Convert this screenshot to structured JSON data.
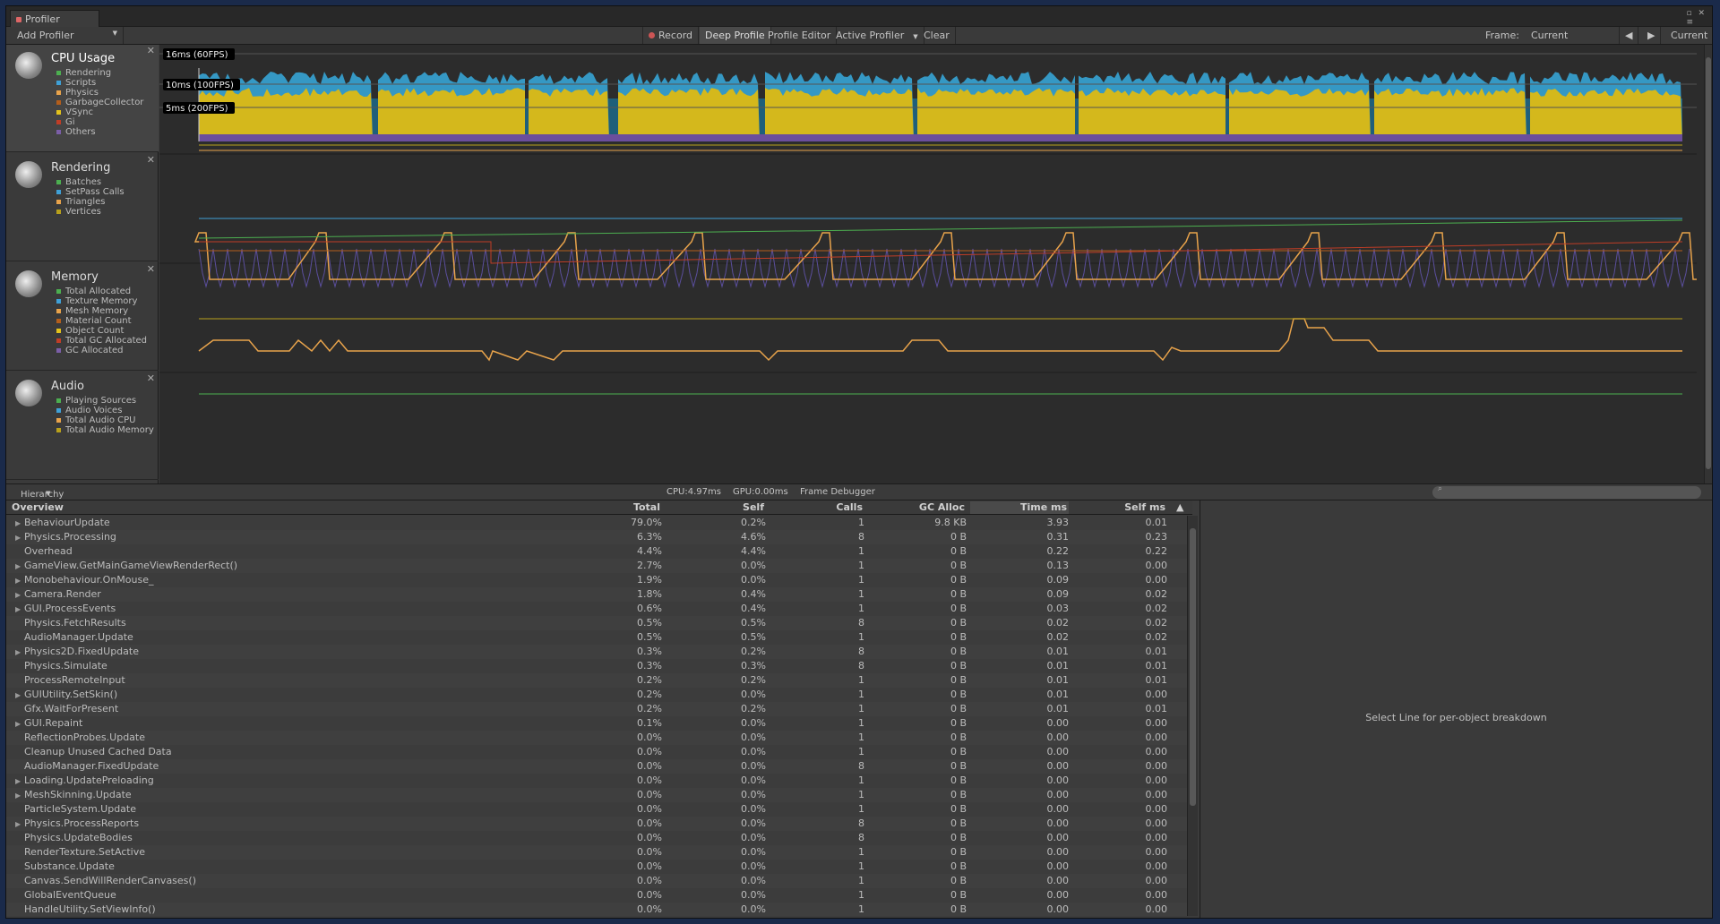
{
  "window": {
    "tab_title": "Profiler"
  },
  "toolbar": {
    "add_profiler": "Add Profiler",
    "record": "Record",
    "deep_profile": "Deep Profile",
    "profile_editor": "Profile Editor",
    "active_profiler": "Active Profiler",
    "clear": "Clear",
    "frame_label": "Frame:",
    "frame_value": "Current",
    "current": "Current"
  },
  "cpu_labels": {
    "l60": "16ms (60FPS)",
    "l100": "10ms (100FPS)",
    "l200": "5ms (200FPS)"
  },
  "legend": [
    {
      "title": "CPU Usage",
      "icon": "cpu-usage-icon",
      "items": [
        {
          "label": "Rendering",
          "color": "#4caf50"
        },
        {
          "label": "Scripts",
          "color": "#3fa0d6"
        },
        {
          "label": "Physics",
          "color": "#e8a34b"
        },
        {
          "label": "GarbageCollector",
          "color": "#b35e1c"
        },
        {
          "label": "VSync",
          "color": "#e2c21c"
        },
        {
          "label": "Gi",
          "color": "#c03d26"
        },
        {
          "label": "Others",
          "color": "#7b5ea7"
        }
      ]
    },
    {
      "title": "Rendering",
      "icon": "rendering-icon",
      "items": [
        {
          "label": "Batches",
          "color": "#4caf50"
        },
        {
          "label": "SetPass Calls",
          "color": "#3fa0d6"
        },
        {
          "label": "Triangles",
          "color": "#e8a34b"
        },
        {
          "label": "Vertices",
          "color": "#b8a01c"
        }
      ]
    },
    {
      "title": "Memory",
      "icon": "memory-icon",
      "items": [
        {
          "label": "Total Allocated",
          "color": "#4caf50"
        },
        {
          "label": "Texture Memory",
          "color": "#3fa0d6"
        },
        {
          "label": "Mesh Memory",
          "color": "#e8a34b"
        },
        {
          "label": "Material Count",
          "color": "#b35e1c"
        },
        {
          "label": "Object Count",
          "color": "#e2c21c"
        },
        {
          "label": "Total GC Allocated",
          "color": "#c03d26"
        },
        {
          "label": "GC Allocated",
          "color": "#7b5ea7"
        }
      ]
    },
    {
      "title": "Audio",
      "icon": "audio-icon",
      "items": [
        {
          "label": "Playing Sources",
          "color": "#4caf50"
        },
        {
          "label": "Audio Voices",
          "color": "#3fa0d6"
        },
        {
          "label": "Total Audio CPU",
          "color": "#e8a34b"
        },
        {
          "label": "Total Audio Memory",
          "color": "#b8a01c"
        }
      ]
    }
  ],
  "hier": {
    "mode": "Hierarchy",
    "cpu": "CPU:4.97ms",
    "gpu": "GPU:0.00ms",
    "frame_debugger": "Frame Debugger"
  },
  "columns": [
    "Overview",
    "Total",
    "Self",
    "Calls",
    "GC Alloc",
    "Time ms",
    "Self ms"
  ],
  "rows": [
    {
      "n": "BehaviourUpdate",
      "e": true,
      "v": [
        "79.0%",
        "0.2%",
        "1",
        "9.8 KB",
        "3.93",
        "0.01"
      ]
    },
    {
      "n": "Physics.Processing",
      "e": true,
      "v": [
        "6.3%",
        "4.6%",
        "8",
        "0 B",
        "0.31",
        "0.23"
      ]
    },
    {
      "n": "Overhead",
      "e": false,
      "v": [
        "4.4%",
        "4.4%",
        "1",
        "0 B",
        "0.22",
        "0.22"
      ]
    },
    {
      "n": "GameView.GetMainGameViewRenderRect()",
      "e": true,
      "v": [
        "2.7%",
        "0.0%",
        "1",
        "0 B",
        "0.13",
        "0.00"
      ]
    },
    {
      "n": "Monobehaviour.OnMouse_",
      "e": true,
      "v": [
        "1.9%",
        "0.0%",
        "1",
        "0 B",
        "0.09",
        "0.00"
      ]
    },
    {
      "n": "Camera.Render",
      "e": true,
      "v": [
        "1.8%",
        "0.4%",
        "1",
        "0 B",
        "0.09",
        "0.02"
      ]
    },
    {
      "n": "GUI.ProcessEvents",
      "e": true,
      "v": [
        "0.6%",
        "0.4%",
        "1",
        "0 B",
        "0.03",
        "0.02"
      ]
    },
    {
      "n": "Physics.FetchResults",
      "e": false,
      "v": [
        "0.5%",
        "0.5%",
        "8",
        "0 B",
        "0.02",
        "0.02"
      ]
    },
    {
      "n": "AudioManager.Update",
      "e": false,
      "v": [
        "0.5%",
        "0.5%",
        "1",
        "0 B",
        "0.02",
        "0.02"
      ]
    },
    {
      "n": "Physics2D.FixedUpdate",
      "e": true,
      "v": [
        "0.3%",
        "0.2%",
        "8",
        "0 B",
        "0.01",
        "0.01"
      ]
    },
    {
      "n": "Physics.Simulate",
      "e": false,
      "v": [
        "0.3%",
        "0.3%",
        "8",
        "0 B",
        "0.01",
        "0.01"
      ]
    },
    {
      "n": "ProcessRemoteInput",
      "e": false,
      "v": [
        "0.2%",
        "0.2%",
        "1",
        "0 B",
        "0.01",
        "0.01"
      ]
    },
    {
      "n": "GUIUtility.SetSkin()",
      "e": true,
      "v": [
        "0.2%",
        "0.0%",
        "1",
        "0 B",
        "0.01",
        "0.00"
      ]
    },
    {
      "n": "Gfx.WaitForPresent",
      "e": false,
      "v": [
        "0.2%",
        "0.2%",
        "1",
        "0 B",
        "0.01",
        "0.01"
      ]
    },
    {
      "n": "GUI.Repaint",
      "e": true,
      "v": [
        "0.1%",
        "0.0%",
        "1",
        "0 B",
        "0.00",
        "0.00"
      ]
    },
    {
      "n": "ReflectionProbes.Update",
      "e": false,
      "v": [
        "0.0%",
        "0.0%",
        "1",
        "0 B",
        "0.00",
        "0.00"
      ]
    },
    {
      "n": "Cleanup Unused Cached Data",
      "e": false,
      "v": [
        "0.0%",
        "0.0%",
        "1",
        "0 B",
        "0.00",
        "0.00"
      ]
    },
    {
      "n": "AudioManager.FixedUpdate",
      "e": false,
      "v": [
        "0.0%",
        "0.0%",
        "8",
        "0 B",
        "0.00",
        "0.00"
      ]
    },
    {
      "n": "Loading.UpdatePreloading",
      "e": true,
      "v": [
        "0.0%",
        "0.0%",
        "1",
        "0 B",
        "0.00",
        "0.00"
      ]
    },
    {
      "n": "MeshSkinning.Update",
      "e": true,
      "v": [
        "0.0%",
        "0.0%",
        "1",
        "0 B",
        "0.00",
        "0.00"
      ]
    },
    {
      "n": "ParticleSystem.Update",
      "e": false,
      "v": [
        "0.0%",
        "0.0%",
        "1",
        "0 B",
        "0.00",
        "0.00"
      ]
    },
    {
      "n": "Physics.ProcessReports",
      "e": true,
      "v": [
        "0.0%",
        "0.0%",
        "8",
        "0 B",
        "0.00",
        "0.00"
      ]
    },
    {
      "n": "Physics.UpdateBodies",
      "e": false,
      "v": [
        "0.0%",
        "0.0%",
        "8",
        "0 B",
        "0.00",
        "0.00"
      ]
    },
    {
      "n": "RenderTexture.SetActive",
      "e": false,
      "v": [
        "0.0%",
        "0.0%",
        "1",
        "0 B",
        "0.00",
        "0.00"
      ]
    },
    {
      "n": "Substance.Update",
      "e": false,
      "v": [
        "0.0%",
        "0.0%",
        "1",
        "0 B",
        "0.00",
        "0.00"
      ]
    },
    {
      "n": "Canvas.SendWillRenderCanvases()",
      "e": false,
      "v": [
        "0.0%",
        "0.0%",
        "1",
        "0 B",
        "0.00",
        "0.00"
      ]
    },
    {
      "n": "GlobalEventQueue",
      "e": false,
      "v": [
        "0.0%",
        "0.0%",
        "1",
        "0 B",
        "0.00",
        "0.00"
      ]
    },
    {
      "n": "HandleUtility.SetViewInfo()",
      "e": false,
      "v": [
        "0.0%",
        "0.0%",
        "1",
        "0 B",
        "0.00",
        "0.00"
      ]
    }
  ],
  "detail": {
    "message": "Select Line for per-object breakdown"
  }
}
